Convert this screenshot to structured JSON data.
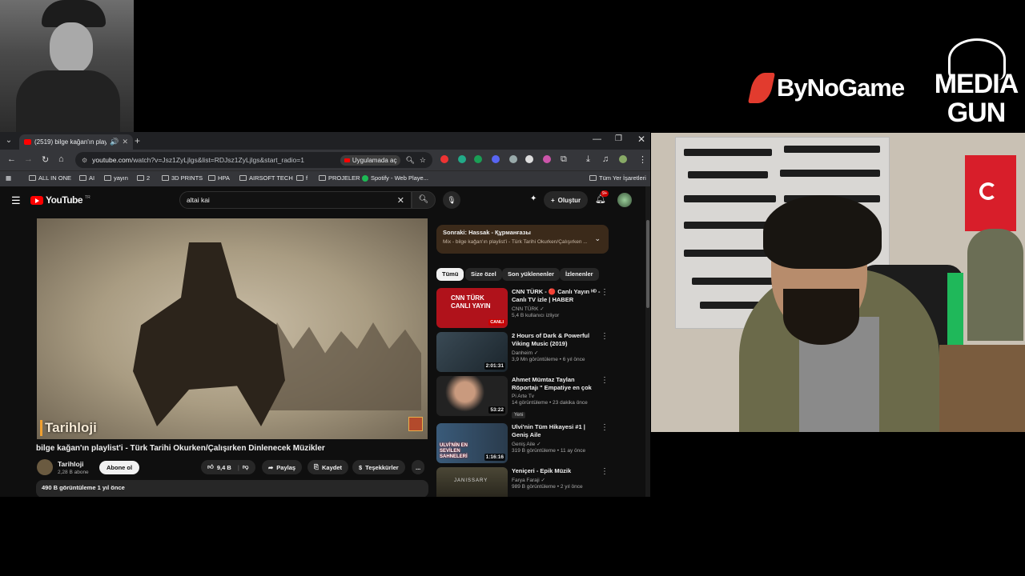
{
  "overlay": {
    "bynogame_logo": "ByNoGame",
    "mediagun_line1": "MEDIA",
    "mediagun_line2": "GUN"
  },
  "browser": {
    "tab_title": "(2519) bilge kağan'ın playlis",
    "url_host": "youtube.com",
    "url_path": "/watch?v=Jsz1ZyLjlgs&list=RDJsz1ZyLjlgs&start_radio=1",
    "open_in_app": "Uygulamada aç",
    "bookmarks": [
      "ALL IN ONE",
      "AI",
      "yayın",
      "2",
      "3D PRINTS",
      "HPA",
      "AIRSOFT TECH",
      "f",
      "PROJELER",
      "Spotify - Web Playe..."
    ],
    "all_bookmarks": "Tüm Yer İşaretleri"
  },
  "youtube": {
    "logo_text": "YouTube",
    "logo_country": "TR",
    "search_query": "altai kai",
    "create_label": "Oluştur",
    "notif_count": "9+",
    "video_watermark": "Tarihloji",
    "video_title": "bilge kağan'ın playlist'i - Türk Tarihi Okurken/Çalışırken Dinlenecek Müzikler",
    "channel_name": "Tarihloji",
    "channel_subs": "2,28 B abone",
    "subscribe_label": "Abone ol",
    "like_count": "9,4 B",
    "share_label": "Paylaş",
    "save_label": "Kaydet",
    "thanks_label": "Teşekkürler",
    "more_label": "...",
    "views_date": "490 B görüntüleme  1 yıl önce",
    "next_title": "Sonraki: Hassak - Құрманғазы",
    "next_sub": "Mix - bilge kağan'ın playlist'i - Türk Tarihi Okurken/Çalışırken ...",
    "chips": [
      "Tümü",
      "Size özel",
      "Son yüklenenler",
      "İzlenenler"
    ],
    "recs": [
      {
        "title": "CNN TÜRK - 🔴 Canlı Yayın ᴴᴰ - Canlı TV izle | HABER",
        "channel": "CNN TÜRK ✓",
        "meta": "5,4 B kullanıcı izliyor",
        "badge": "CANLI",
        "duration": "",
        "thumb_text": "CNN TÜRK CANLI YAYIN",
        "is_new": ""
      },
      {
        "title": "2 Hours of Dark & Powerful Viking Music (2019)",
        "channel": "Danheim ✓",
        "meta": "3,9 Mn görüntüleme • 6 yıl önce",
        "badge": "",
        "duration": "2:01:31",
        "thumb_text": "",
        "is_new": ""
      },
      {
        "title": "Ahmet Mümtaz Taylan Röportajı \" Empatiye en çok ihtiyaç ...",
        "channel": "Pi Arte Tv",
        "meta": "14 görüntüleme • 23 dakika önce",
        "badge": "",
        "duration": "53:22",
        "thumb_text": "",
        "is_new": "Yeni"
      },
      {
        "title": "Ulvi'nin Tüm Hikayesi #1 | Geniş Aile",
        "channel": "Geniş Aile ✓",
        "meta": "319 B görüntüleme • 11 ay önce",
        "badge": "",
        "duration": "1:16:16",
        "thumb_text": "ULVİ'NİN EN SEVİLEN SAHNELERİ",
        "is_new": ""
      },
      {
        "title": "Yeniçeri - Epik Müzik",
        "channel": "Farya Faraji ✓",
        "meta": "989 B görüntüleme • 2 yıl önce",
        "badge": "",
        "duration": "",
        "thumb_text": "JANISSARY",
        "is_new": ""
      }
    ]
  }
}
